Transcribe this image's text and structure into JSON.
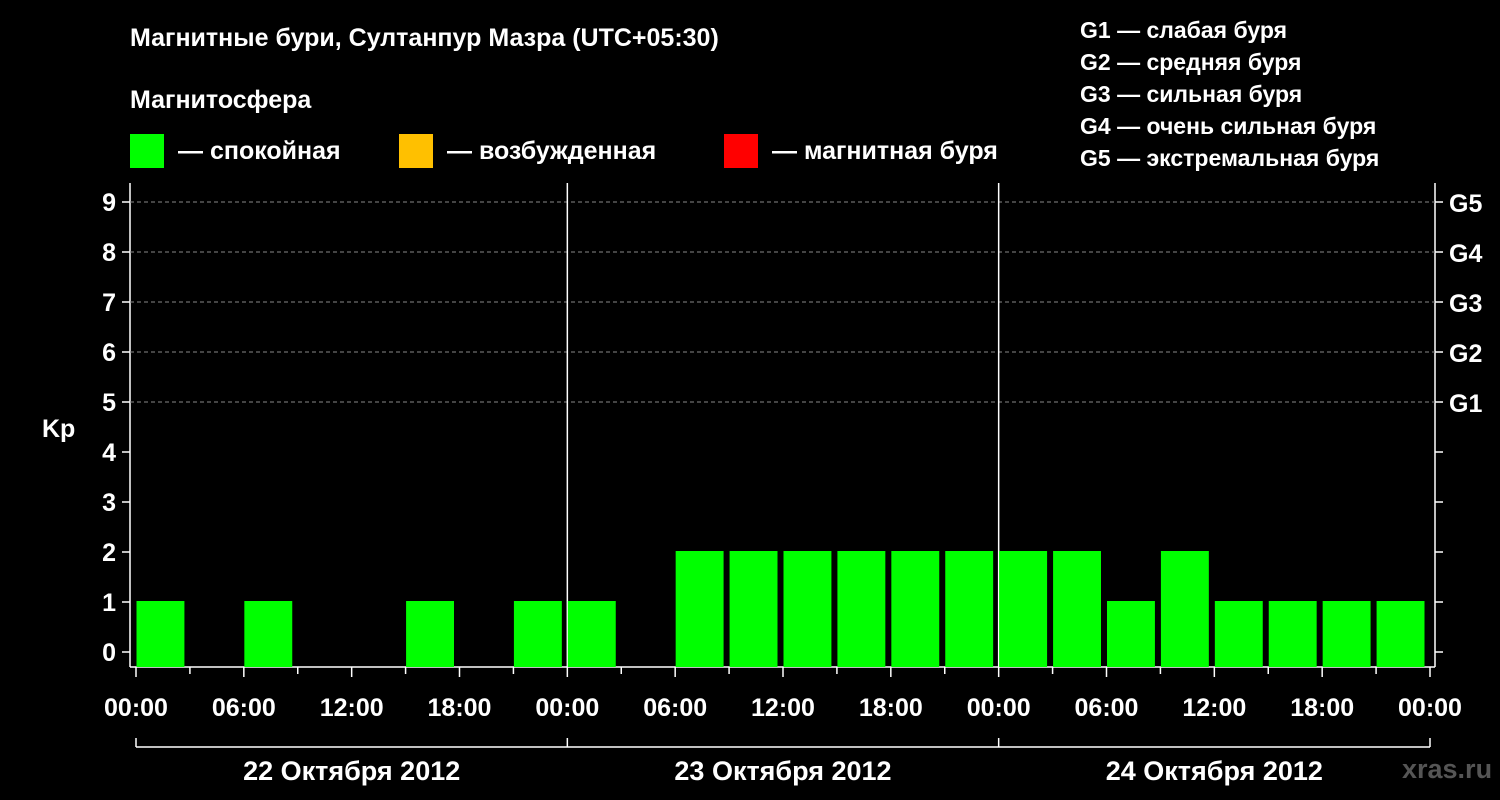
{
  "header": {
    "title": "Магнитные бури, Султанпур Мазра (UTC+05:30)",
    "legend_title": "Магнитосфера",
    "legend": [
      {
        "label": "— спокойная",
        "color": "#00ff00"
      },
      {
        "label": "— возбужденная",
        "color": "#ffc000"
      },
      {
        "label": "— магнитная буря",
        "color": "#ff0000"
      }
    ],
    "g_scale": [
      "G1 — слабая буря",
      "G2 — средняя буря",
      "G3 — сильная буря",
      "G4 — очень сильная буря",
      "G5 — экстремальная буря"
    ]
  },
  "watermark": "xras.ru",
  "chart_data": {
    "type": "bar",
    "ylabel": "Kp",
    "ylim": [
      0,
      9
    ],
    "yticks": [
      "0",
      "1",
      "2",
      "3",
      "4",
      "5",
      "6",
      "7",
      "8",
      "9"
    ],
    "right_ticks": [
      {
        "kp": 5,
        "label": "G1"
      },
      {
        "kp": 6,
        "label": "G2"
      },
      {
        "kp": 7,
        "label": "G3"
      },
      {
        "kp": 8,
        "label": "G4"
      },
      {
        "kp": 9,
        "label": "G5"
      }
    ],
    "grid": "dashed at Kp 5-9",
    "xticks": [
      "00:00",
      "06:00",
      "12:00",
      "18:00",
      "00:00",
      "06:00",
      "12:00",
      "18:00",
      "00:00",
      "06:00",
      "12:00",
      "18:00",
      "00:00"
    ],
    "days": [
      "22 Октября 2012",
      "23 Октября 2012",
      "24 Октября 2012"
    ],
    "interval_hours": 3,
    "values": [
      1,
      0,
      1,
      0,
      0,
      1,
      0,
      1,
      1,
      0,
      2,
      2,
      2,
      2,
      2,
      2,
      2,
      2,
      1,
      2,
      1,
      1,
      1,
      1
    ],
    "bar_color": "#00ff00"
  }
}
